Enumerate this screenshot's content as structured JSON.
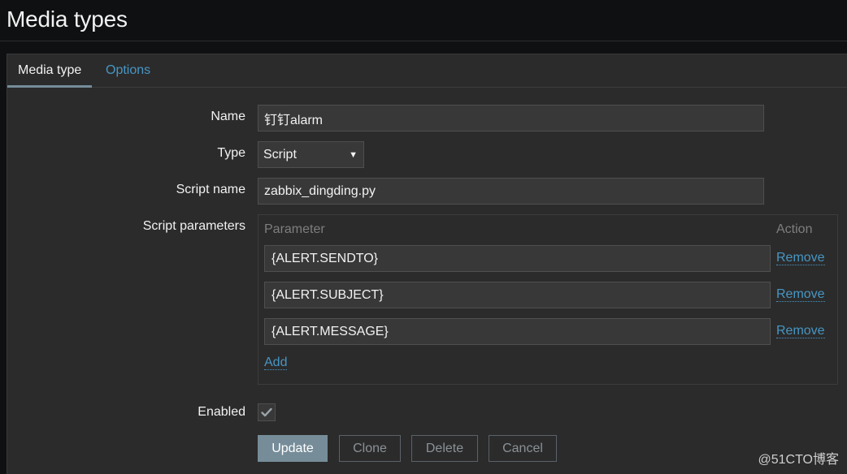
{
  "page": {
    "title": "Media types"
  },
  "tabs": [
    {
      "label": "Media type",
      "active": true
    },
    {
      "label": "Options",
      "active": false
    }
  ],
  "form": {
    "name_label": "Name",
    "name_value": "钉钉alarm",
    "type_label": "Type",
    "type_value": "Script",
    "script_name_label": "Script name",
    "script_name_value": "zabbix_dingding.py",
    "script_params_label": "Script parameters",
    "params": {
      "col_parameter": "Parameter",
      "col_action": "Action",
      "rows": [
        {
          "value": "{ALERT.SENDTO}",
          "action": "Remove"
        },
        {
          "value": "{ALERT.SUBJECT}",
          "action": "Remove"
        },
        {
          "value": "{ALERT.MESSAGE}",
          "action": "Remove"
        }
      ],
      "add_label": "Add"
    },
    "enabled_label": "Enabled",
    "enabled_checked": true
  },
  "buttons": {
    "update": "Update",
    "clone": "Clone",
    "delete": "Delete",
    "cancel": "Cancel"
  },
  "watermark": "@51CTO博客",
  "colors": {
    "background": "#0e1012",
    "panel": "#2b2b2b",
    "input": "#383838",
    "link": "#4796c4",
    "primary_button": "#768d99",
    "text": "#f2f2f2"
  }
}
